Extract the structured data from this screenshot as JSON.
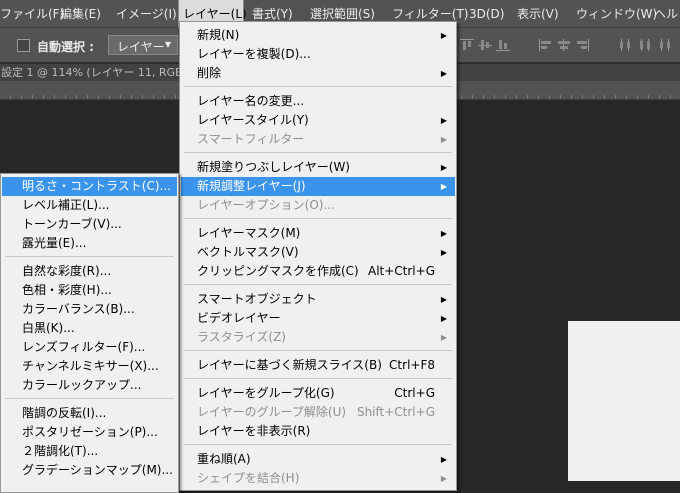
{
  "menubar": {
    "items": [
      "ファイル(F)",
      "編集(E)",
      "イメージ(I)",
      "レイヤー(L)",
      "書式(Y)",
      "選択範囲(S)",
      "フィルター(T)",
      "3D(D)",
      "表示(V)",
      "ウィンドウ(W)",
      "ヘル"
    ]
  },
  "options": {
    "auto_select_label": "自動選択 :",
    "target_value": "レイヤー"
  },
  "document": {
    "tab_text": "設定 1 @ 114% (レイヤー 11, RGB/"
  },
  "layer_menu": {
    "items": [
      {
        "label": "新規(N)",
        "arrow": true
      },
      {
        "label": "レイヤーを複製(D)..."
      },
      {
        "label": "削除",
        "arrow": true
      },
      {
        "label": "レイヤー名の変更..."
      },
      {
        "label": "レイヤースタイル(Y)",
        "arrow": true
      },
      {
        "label": "スマートフィルター",
        "arrow": true,
        "disabled": true
      },
      {
        "label": "新規塗りつぶしレイヤー(W)",
        "arrow": true
      },
      {
        "label": "新規調整レイヤー(J)",
        "arrow": true,
        "highlighted": true
      },
      {
        "label": "レイヤーオプション(O)...",
        "disabled": true
      },
      {
        "label": "レイヤーマスク(M)",
        "arrow": true
      },
      {
        "label": "ベクトルマスク(V)",
        "arrow": true
      },
      {
        "label": "クリッピングマスクを作成(C)",
        "shortcut": "Alt+Ctrl+G"
      },
      {
        "label": "スマートオブジェクト",
        "arrow": true
      },
      {
        "label": "ビデオレイヤー",
        "arrow": true
      },
      {
        "label": "ラスタライズ(Z)",
        "arrow": true,
        "disabled": true
      },
      {
        "label": "レイヤーに基づく新規スライス(B)",
        "shortcut": "Ctrl+F8"
      },
      {
        "label": "レイヤーをグループ化(G)",
        "shortcut": "Ctrl+G"
      },
      {
        "label": "レイヤーのグループ解除(U)",
        "shortcut": "Shift+Ctrl+G",
        "disabled": true
      },
      {
        "label": "レイヤーを非表示(R)"
      },
      {
        "label": "重ね順(A)",
        "arrow": true
      },
      {
        "label": "シェイプを結合(H)",
        "arrow": true,
        "disabled": true
      }
    ]
  },
  "adjustment_submenu": {
    "items": [
      {
        "label": "明るさ・コントラスト(C)...",
        "highlighted": true
      },
      {
        "label": "レベル補正(L)..."
      },
      {
        "label": "トーンカーブ(V)..."
      },
      {
        "label": "露光量(E)..."
      },
      {
        "label": "自然な彩度(R)..."
      },
      {
        "label": "色相・彩度(H)..."
      },
      {
        "label": "カラーバランス(B)..."
      },
      {
        "label": "白黒(K)..."
      },
      {
        "label": "レンズフィルター(F)..."
      },
      {
        "label": "チャンネルミキサー(X)..."
      },
      {
        "label": "カラールックアップ..."
      },
      {
        "label": "階調の反転(I)..."
      },
      {
        "label": "ポスタリゼーション(P)..."
      },
      {
        "label": "２階調化(T)..."
      },
      {
        "label": "グラデーションマップ(M)..."
      }
    ]
  },
  "colors": {
    "ui_dark": "#535353",
    "workspace": "#282828",
    "menu_bg": "#f0f0f0",
    "highlight": "#3a94ec",
    "disabled_text": "#8f8f8f"
  }
}
